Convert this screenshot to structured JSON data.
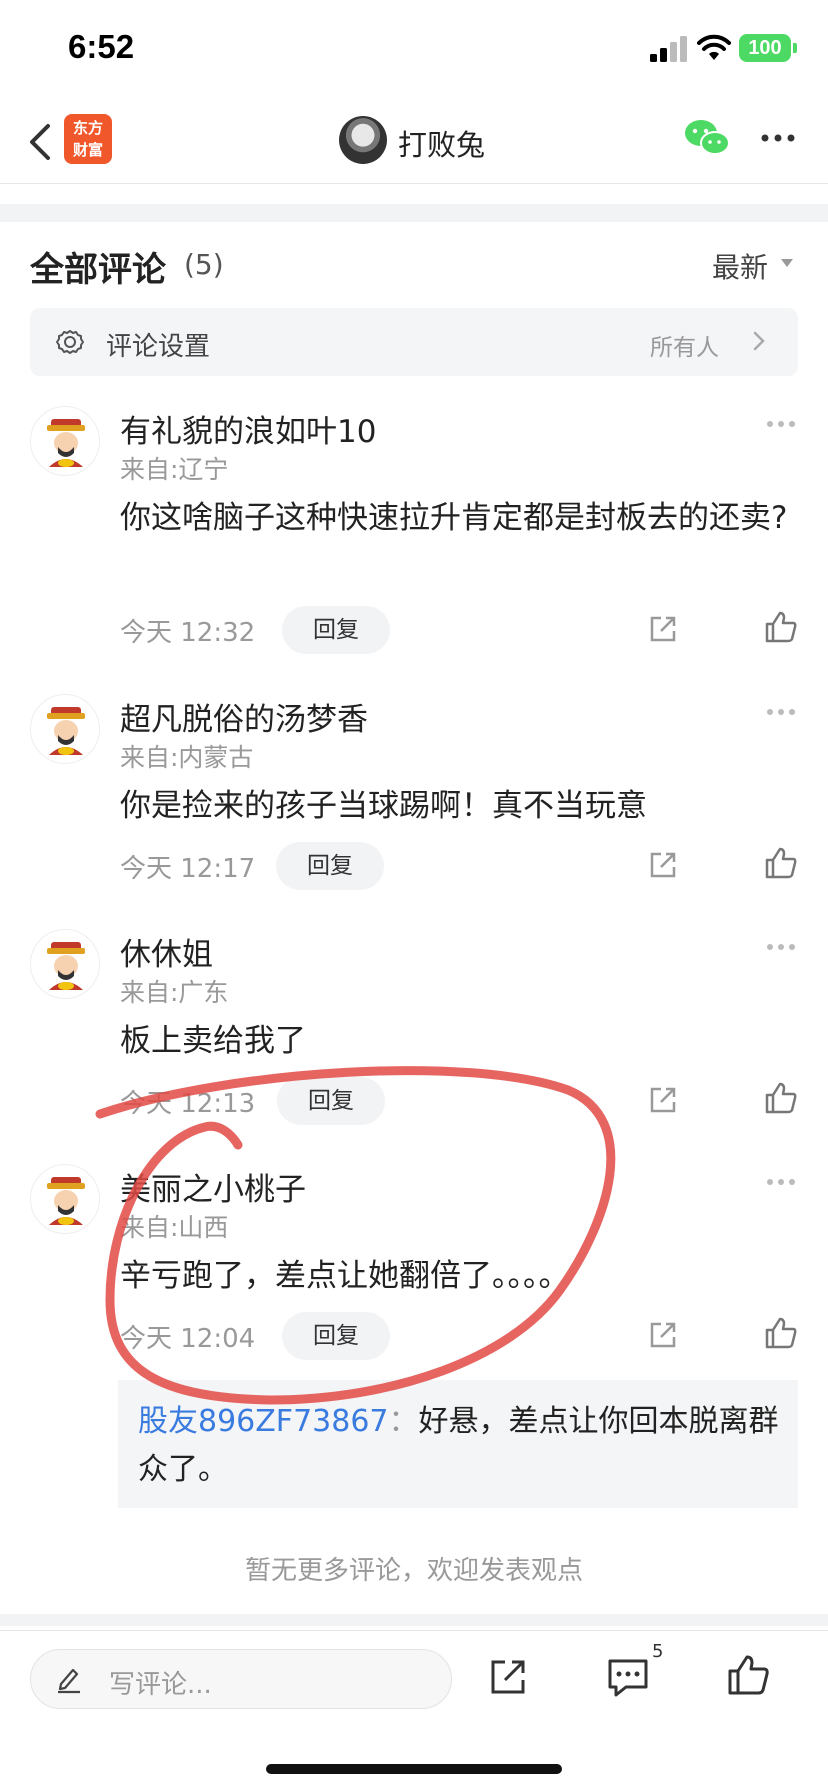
{
  "status_bar": {
    "time": "6:52",
    "battery": "100"
  },
  "nav": {
    "logo_line1": "东方",
    "logo_line2": "财富",
    "author": "打败兔"
  },
  "header": {
    "title": "全部评论",
    "count": "(5)",
    "sort": "最新"
  },
  "settings": {
    "label": "评论设置",
    "value": "所有人"
  },
  "comments": [
    {
      "name": "有礼貌的浪如叶10",
      "location": "来自:辽宁",
      "text": "你这啥脑子这种快速拉升肯定都是封板去的还卖?",
      "time": "今天 12:32",
      "reply": "回复"
    },
    {
      "name": "超凡脱俗的汤梦香",
      "location": "来自:内蒙古",
      "text": "你是捡来的孩子当球踢啊！真不当玩意",
      "time": "今天 12:17",
      "reply": "回复"
    },
    {
      "name": "休休姐",
      "location": "来自:广东",
      "text": "板上卖给我了",
      "time": "今天 12:13",
      "reply": "回复"
    },
    {
      "name": "美丽之小桃子",
      "location": "来自:山西",
      "text": "辛亏跑了，差点让她翻倍了。。。。",
      "time": "今天 12:04",
      "reply": "回复"
    }
  ],
  "sub_reply": {
    "user": "股友896ZF73867",
    "separator": "：",
    "text": "好悬，差点让你回本脱离群众了。"
  },
  "footer_text": "暂无更多评论，欢迎发表观点",
  "bottom": {
    "placeholder": "写评论...",
    "comment_count": "5"
  },
  "colors": {
    "annotation": "#e34a45",
    "link": "#3a7be0",
    "brand": "#f0582c",
    "wechat": "#4cd964"
  }
}
